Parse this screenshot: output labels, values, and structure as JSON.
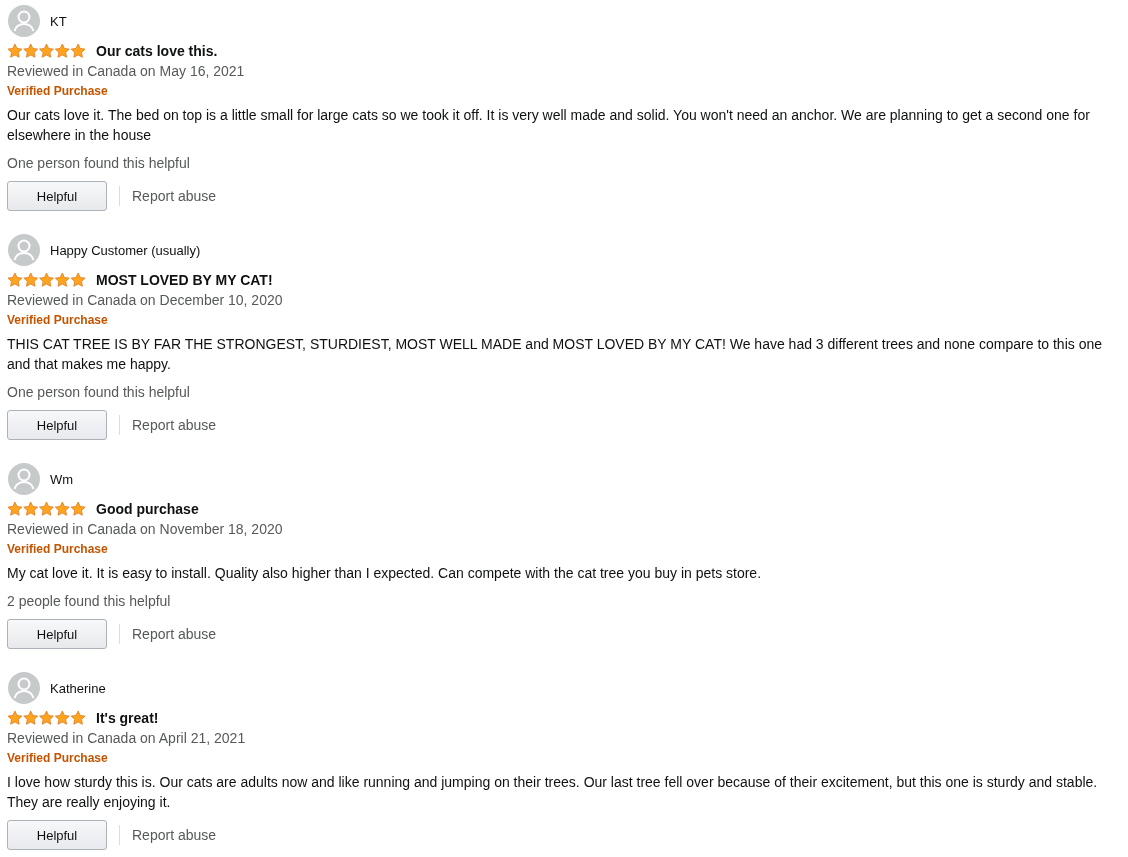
{
  "reviews": [
    {
      "author": "KT",
      "stars": 5,
      "title": "Our cats love this.",
      "date": "Reviewed in Canada on May 16, 2021",
      "badge": "Verified Purchase",
      "body": "Our cats love it. The bed on top is a little small for large cats so we took it off. It is very well made and solid. You won't need an anchor. We are planning to get a second one for elsewhere in the house",
      "helpful_count": "One person found this helpful",
      "helpful_button": "Helpful",
      "report_link": "Report abuse"
    },
    {
      "author": "Happy Customer (usually)",
      "stars": 5,
      "title": "MOST LOVED BY MY CAT!",
      "date": "Reviewed in Canada on December 10, 2020",
      "badge": "Verified Purchase",
      "body": "THIS CAT TREE IS BY FAR THE STRONGEST, STURDIEST, MOST WELL MADE and MOST LOVED BY MY CAT! We have had 3 different trees and none compare to this one and that makes me happy.",
      "helpful_count": "One person found this helpful",
      "helpful_button": "Helpful",
      "report_link": "Report abuse"
    },
    {
      "author": "Wm",
      "stars": 5,
      "title": "Good purchase",
      "date": "Reviewed in Canada on November 18, 2020",
      "badge": "Verified Purchase",
      "body": "My cat love it. It is easy to install. Quality also higher than I expected. Can compete with the cat tree you buy in pets store.",
      "helpful_count": "2 people found this helpful",
      "helpful_button": "Helpful",
      "report_link": "Report abuse"
    },
    {
      "author": "Katherine",
      "stars": 5,
      "title": "It's great!",
      "date": "Reviewed in Canada on April 21, 2021",
      "badge": "Verified Purchase",
      "body": "I love how sturdy this is. Our cats are adults now and like running and jumping on their trees. Our last tree fell over because of their excitement, but this one is sturdy and stable. They are really enjoying it.",
      "helpful_button": "Helpful",
      "report_link": "Report abuse"
    }
  ]
}
